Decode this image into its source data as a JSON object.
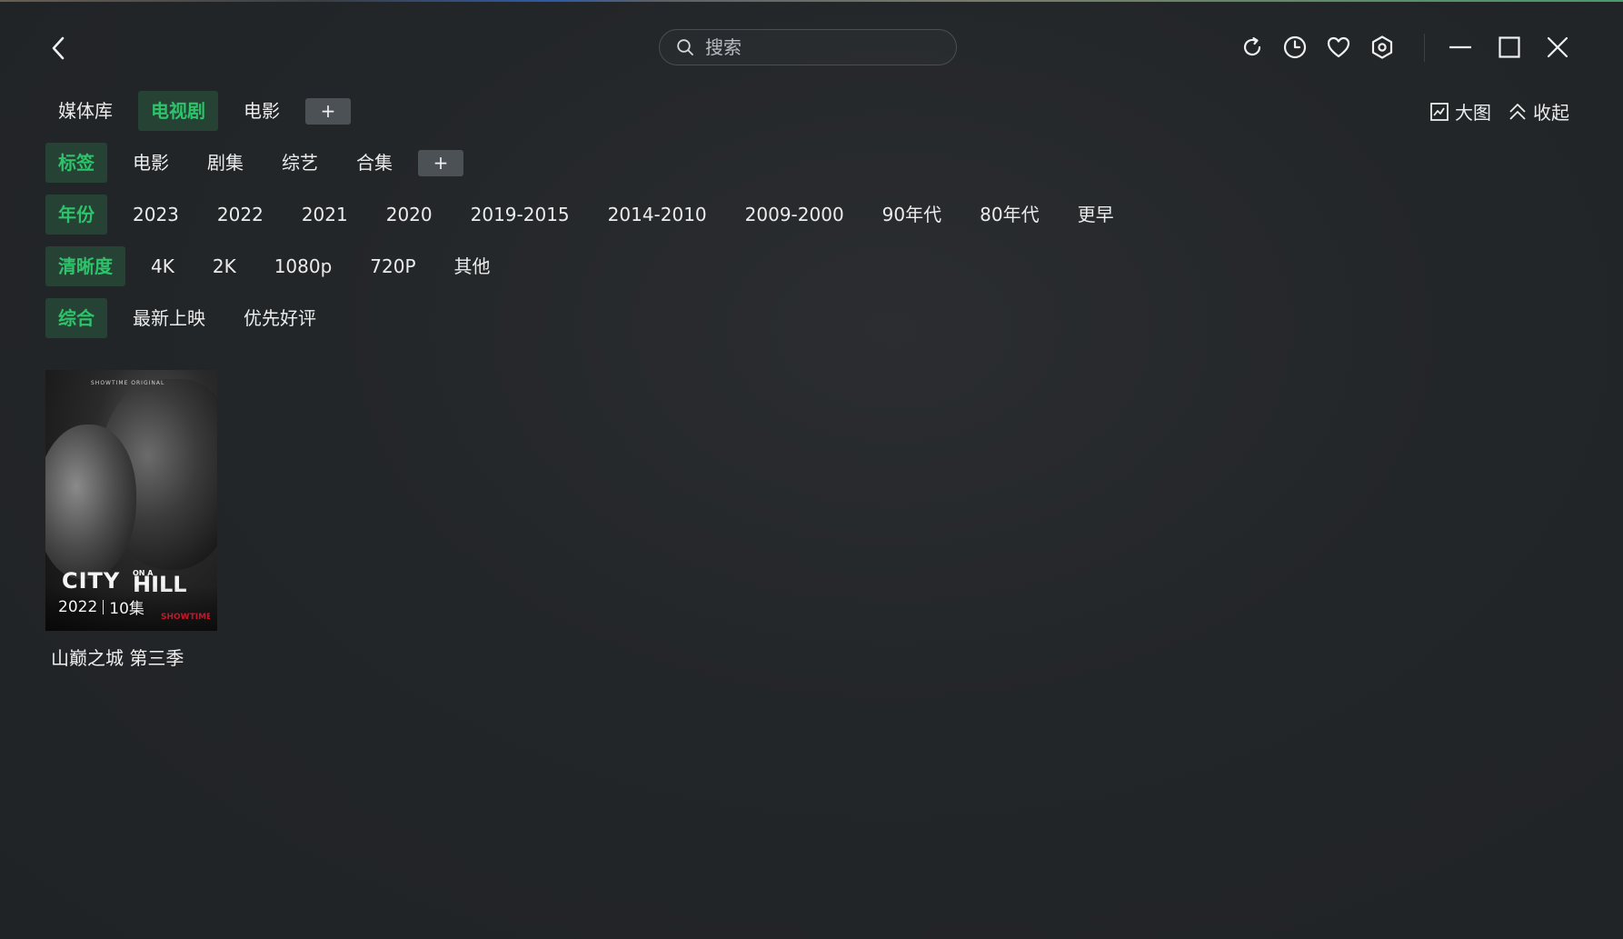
{
  "search": {
    "placeholder": "搜索"
  },
  "top_tabs": {
    "items": [
      {
        "label": "媒体库",
        "active": false
      },
      {
        "label": "电视剧",
        "active": true
      },
      {
        "label": "电影",
        "active": false
      }
    ],
    "add_label": "+"
  },
  "right_actions": {
    "big_view_label": "大图",
    "collapse_label": "收起"
  },
  "filters": {
    "tags": {
      "label": "标签",
      "options": [
        "电影",
        "剧集",
        "综艺",
        "合集"
      ],
      "add_label": "+"
    },
    "year": {
      "label": "年份",
      "options": [
        "2023",
        "2022",
        "2021",
        "2020",
        "2019-2015",
        "2014-2010",
        "2009-2000",
        "90年代",
        "80年代",
        "更早"
      ]
    },
    "resolution": {
      "label": "清晰度",
      "options": [
        "4K",
        "2K",
        "1080p",
        "720P",
        "其他"
      ]
    },
    "sort": {
      "active_label": "综合",
      "options": [
        "最新上映",
        "优先好评"
      ]
    }
  },
  "items": [
    {
      "title": "山巅之城 第三季",
      "year": "2022",
      "episodes": "10集",
      "poster_logo": "CITY ON A HILL",
      "poster_top": "SHOWTIME ORIGINAL",
      "poster_network": "SHOWTIME"
    }
  ],
  "icons": {
    "back": "chevron-left-icon",
    "search": "search-icon",
    "refresh": "refresh-icon",
    "history": "clock-icon",
    "favorite": "heart-icon",
    "settings": "hexagon-settings-icon",
    "minimize": "minimize-icon",
    "maximize": "maximize-icon",
    "close": "close-icon",
    "big_view": "image-icon",
    "collapse": "double-chevron-up-icon"
  },
  "colors": {
    "accent": "#2ec36a",
    "accent_bg": "#254235",
    "background": "#232629",
    "plus_button": "#4c5156"
  }
}
